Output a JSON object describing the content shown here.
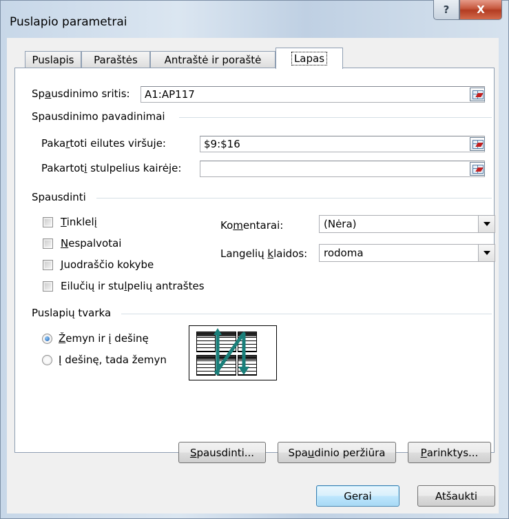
{
  "window": {
    "title": "Puslapio parametrai",
    "help_glyph": "?",
    "close_glyph": "X"
  },
  "tabs": [
    {
      "label": "Puslapis",
      "active": false
    },
    {
      "label": "Paraštės",
      "active": false
    },
    {
      "label": "Antraštė ir poraštė",
      "active": false
    },
    {
      "label": "Lapas",
      "active": true
    }
  ],
  "print_area": {
    "label_pre": "Sp",
    "label_u": "a",
    "label_post": "usdinimo sritis:",
    "value": "A1:AP117"
  },
  "print_titles": {
    "heading": "Spausdinimo pavadinimai",
    "rows_label_pre": "Paka",
    "rows_label_u": "r",
    "rows_label_post": "toti eilutes viršuje:",
    "rows_value": "$9:$16",
    "cols_label_pre": "Pakartot",
    "cols_label_u": "i",
    "cols_label_post": " stulpelius kairėje:",
    "cols_value": ""
  },
  "print": {
    "heading": "Spausdinti",
    "checkboxes": [
      {
        "u": "T",
        "rest": "inklelį",
        "checked": false
      },
      {
        "u": "N",
        "rest": "espalvotai",
        "checked": false
      },
      {
        "u": "J",
        "rest": "uodraščio kokybe",
        "checked": false
      },
      {
        "pre": "Eilučių ir stu",
        "u": "l",
        "rest": "pelių antraštes",
        "checked": false
      }
    ],
    "comments_label_pre": "Ko",
    "comments_label_u": "m",
    "comments_label_post": "entarai:",
    "comments_value": "(Nėra)",
    "errors_label_pre": "Langelių ",
    "errors_label_u": "k",
    "errors_label_post": "laidos:",
    "errors_value": "rodoma"
  },
  "page_order": {
    "heading": "Puslapių tvarka",
    "options": [
      {
        "u": "Ž",
        "rest": "emyn ir į dešinę",
        "selected": true
      },
      {
        "u": "Į",
        "rest": " dešinę, tada žemyn",
        "selected": false
      }
    ]
  },
  "buttons": {
    "print_pre": "",
    "print_u": "S",
    "print_post": "pausdinti...",
    "preview_pre": "Spa",
    "preview_u": "u",
    "preview_post": "dinio peržiūra",
    "options_pre": "",
    "options_u": "P",
    "options_post": "arinktys...",
    "ok": "Gerai",
    "cancel": "Atšaukti"
  },
  "colors": {
    "accent_arrow": "#1a7f7a",
    "close_red": "#c75a40",
    "default_border": "#3c7fb1"
  }
}
